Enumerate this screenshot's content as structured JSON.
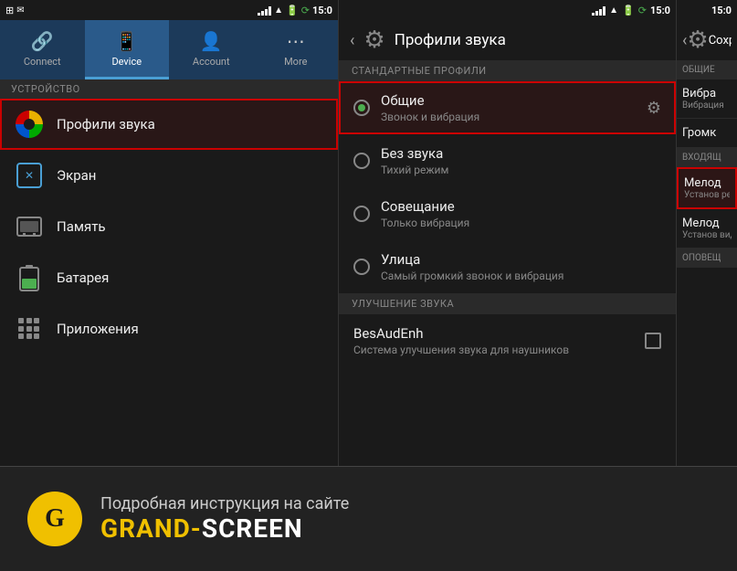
{
  "panel1": {
    "statusBar": {
      "time": "15:0",
      "icons": [
        "signal",
        "wifi",
        "battery"
      ]
    },
    "tabs": [
      {
        "id": "connect",
        "label": "Connect",
        "icon": "🔗",
        "active": false
      },
      {
        "id": "device",
        "label": "Device",
        "icon": "📱",
        "active": true
      },
      {
        "id": "account",
        "label": "Account",
        "icon": "👤",
        "active": false
      },
      {
        "id": "more",
        "label": "More",
        "icon": "⋯",
        "active": false
      }
    ],
    "sectionHeader": "УСТРОЙСТВО",
    "menuItems": [
      {
        "id": "sound",
        "label": "Профили звука",
        "highlighted": true
      },
      {
        "id": "screen",
        "label": "Экран",
        "highlighted": false
      },
      {
        "id": "memory",
        "label": "Память",
        "highlighted": false
      },
      {
        "id": "battery",
        "label": "Батарея",
        "highlighted": false
      },
      {
        "id": "apps",
        "label": "Приложения",
        "highlighted": false
      }
    ]
  },
  "panel2": {
    "statusBar": {
      "time": "15:0"
    },
    "title": "Профили звука",
    "standardProfilesHeader": "СТАНДАРТНЫЕ ПРОФИЛИ",
    "profiles": [
      {
        "id": "general",
        "name": "Общие",
        "desc": "Звонок и вибрация",
        "selected": true,
        "hasGear": true
      },
      {
        "id": "silent",
        "name": "Без звука",
        "desc": "Тихий режим",
        "selected": false,
        "hasGear": false
      },
      {
        "id": "meeting",
        "name": "Совещание",
        "desc": "Только вибрация",
        "selected": false,
        "hasGear": false
      },
      {
        "id": "street",
        "name": "Улица",
        "desc": "Самый громкий звонок и вибрация",
        "selected": false,
        "hasGear": false
      }
    ],
    "soundEnhanceHeader": "УЛУЧШЕНИЕ ЗВУКА",
    "enhanceItem": {
      "name": "BesAudEnh",
      "desc": "Система улучшения звука для наушников"
    }
  },
  "panel3": {
    "statusBar": {
      "time": "15:0"
    },
    "title": "Сохр",
    "generalSection": "ОБЩИЕ",
    "items": [
      {
        "id": "vibra",
        "title": "Вибра",
        "desc": "Вибрация",
        "incoming": false
      },
      {
        "id": "volume",
        "title": "Громк",
        "desc": "",
        "incoming": false
      }
    ],
    "incomingSection": "ВХОДЯЩ",
    "incomingItems": [
      {
        "id": "melody1",
        "title": "Мелод",
        "desc": "Установ речевых",
        "highlighted": true
      },
      {
        "id": "melody2",
        "title": "Мелод",
        "desc": "Установ видеов",
        "highlighted": false
      }
    ],
    "notifSection": "ОПОВЕЩ"
  },
  "banner": {
    "logoLetter": "G",
    "subtitle": "Подробная инструкция на сайте",
    "brandPrefix": "GRAND-",
    "brandSuffix": "SCREEN"
  }
}
